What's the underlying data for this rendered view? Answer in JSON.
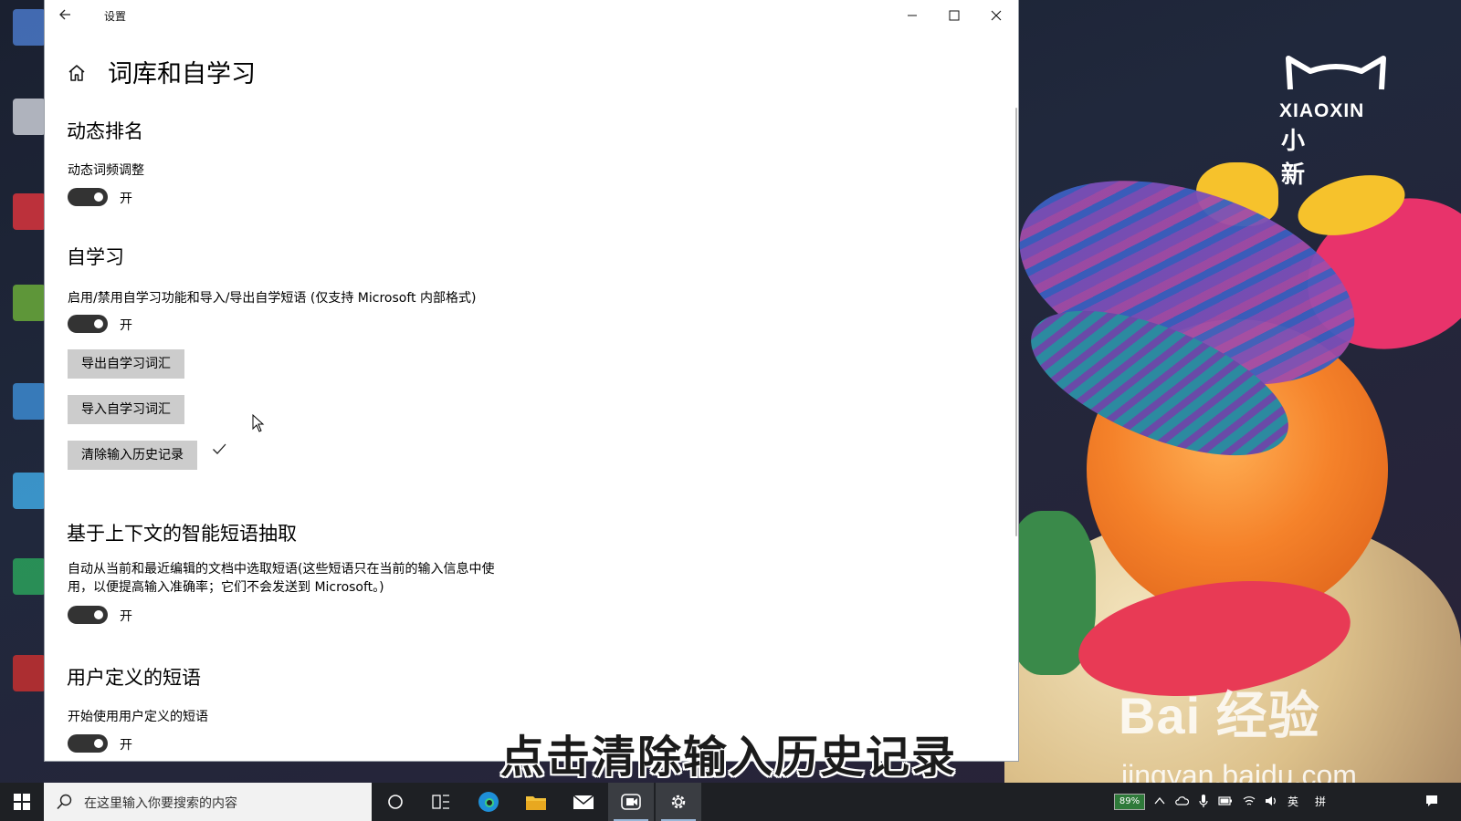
{
  "window": {
    "title": "设置",
    "page_title": "词库和自学习"
  },
  "sections": {
    "dynamic_rank": {
      "title": "动态排名",
      "setting_label": "动态词频调整",
      "toggle_state": "开"
    },
    "self_learning": {
      "title": "自学习",
      "setting_label": "启用/禁用自学习功能和导入/导出自学短语 (仅支持 Microsoft 内部格式)",
      "toggle_state": "开",
      "export_button": "导出自学习词汇",
      "import_button": "导入自学习词汇",
      "clear_button": "清除输入历史记录"
    },
    "context_phrase": {
      "title": "基于上下文的智能短语抽取",
      "description": "自动从当前和最近编辑的文档中选取短语(这些短语只在当前的输入信息中使用，以便提高输入准确率；它们不会发送到 Microsoft。)",
      "toggle_state": "开"
    },
    "user_phrase": {
      "title": "用户定义的短语",
      "setting_label": "开始使用用户定义的短语",
      "toggle_state": "开"
    }
  },
  "overlay": {
    "caption": "点击清除输入历史记录",
    "brand_en": "XIAOXIN",
    "brand_cn": "小新",
    "watermark_main": "Bai 经验",
    "watermark_url": "jingyan.baidu.com"
  },
  "taskbar": {
    "search_placeholder": "在这里输入你要搜索的内容",
    "battery_percent": "89%",
    "ime_lang": "英",
    "ime_mode": "拼"
  },
  "colors": {
    "toggle_on": "#333333",
    "button_bg": "#cccccc",
    "taskbar_bg": "#1e2024"
  }
}
